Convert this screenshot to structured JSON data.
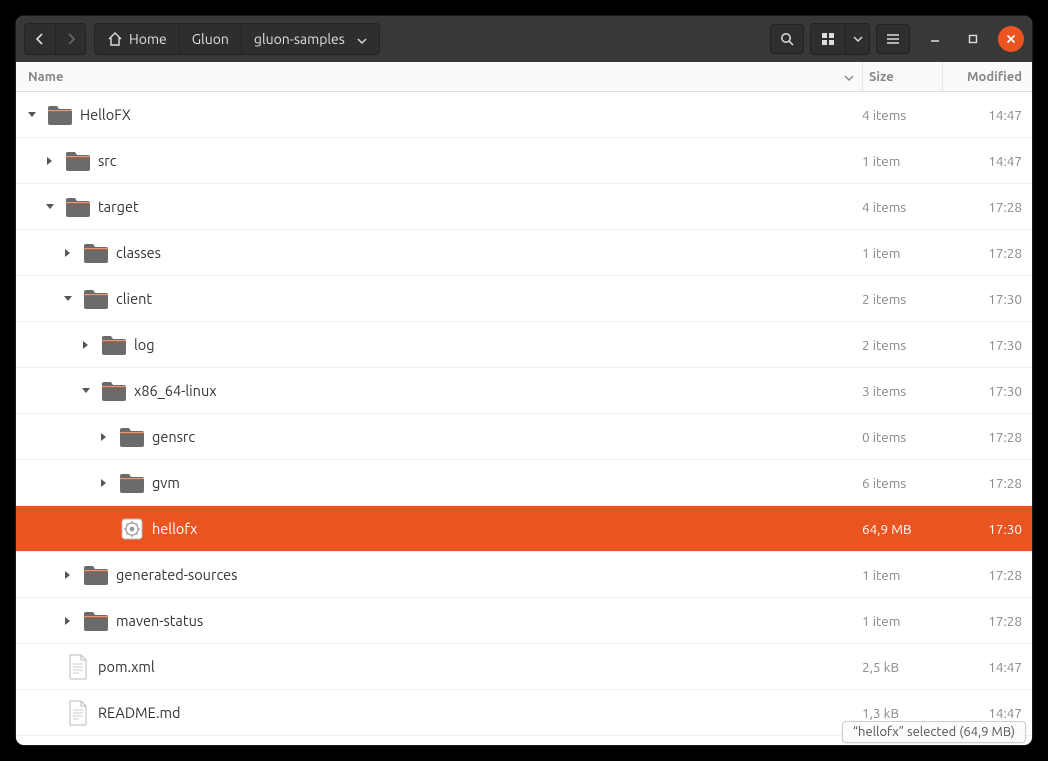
{
  "breadcrumb": {
    "home": "Home",
    "seg1": "Gluon",
    "seg2": "gluon-samples"
  },
  "columns": {
    "name": "Name",
    "size": "Size",
    "modified": "Modified"
  },
  "rows": [
    {
      "indent": 0,
      "expander": "down",
      "icon": "folder",
      "name": "HelloFX",
      "size": "4 items",
      "mod": "14:47",
      "selected": false
    },
    {
      "indent": 1,
      "expander": "right",
      "icon": "folder",
      "name": "src",
      "size": "1 item",
      "mod": "14:47",
      "selected": false
    },
    {
      "indent": 1,
      "expander": "down",
      "icon": "folder",
      "name": "target",
      "size": "4 items",
      "mod": "17:28",
      "selected": false
    },
    {
      "indent": 2,
      "expander": "right",
      "icon": "folder",
      "name": "classes",
      "size": "1 item",
      "mod": "17:28",
      "selected": false
    },
    {
      "indent": 2,
      "expander": "down",
      "icon": "folder",
      "name": "client",
      "size": "2 items",
      "mod": "17:30",
      "selected": false
    },
    {
      "indent": 3,
      "expander": "right",
      "icon": "folder",
      "name": "log",
      "size": "2 items",
      "mod": "17:30",
      "selected": false
    },
    {
      "indent": 3,
      "expander": "down",
      "icon": "folder",
      "name": "x86_64-linux",
      "size": "3 items",
      "mod": "17:30",
      "selected": false
    },
    {
      "indent": 4,
      "expander": "right",
      "icon": "folder",
      "name": "gensrc",
      "size": "0 items",
      "mod": "17:28",
      "selected": false
    },
    {
      "indent": 4,
      "expander": "right",
      "icon": "folder",
      "name": "gvm",
      "size": "6 items",
      "mod": "17:28",
      "selected": false
    },
    {
      "indent": 4,
      "expander": "none",
      "icon": "exec",
      "name": "hellofx",
      "size": "64,9 MB",
      "mod": "17:30",
      "selected": true
    },
    {
      "indent": 2,
      "expander": "right",
      "icon": "folder",
      "name": "generated-sources",
      "size": "1 item",
      "mod": "17:28",
      "selected": false
    },
    {
      "indent": 2,
      "expander": "right",
      "icon": "folder",
      "name": "maven-status",
      "size": "1 item",
      "mod": "17:28",
      "selected": false
    },
    {
      "indent": 1,
      "expander": "none",
      "icon": "text",
      "name": "pom.xml",
      "size": "2,5 kB",
      "mod": "14:47",
      "selected": false
    },
    {
      "indent": 1,
      "expander": "none",
      "icon": "text",
      "name": "README.md",
      "size": "1,3 kB",
      "mod": "14:47",
      "selected": false
    }
  ],
  "status": "“hellofx” selected  (64,9 MB)"
}
